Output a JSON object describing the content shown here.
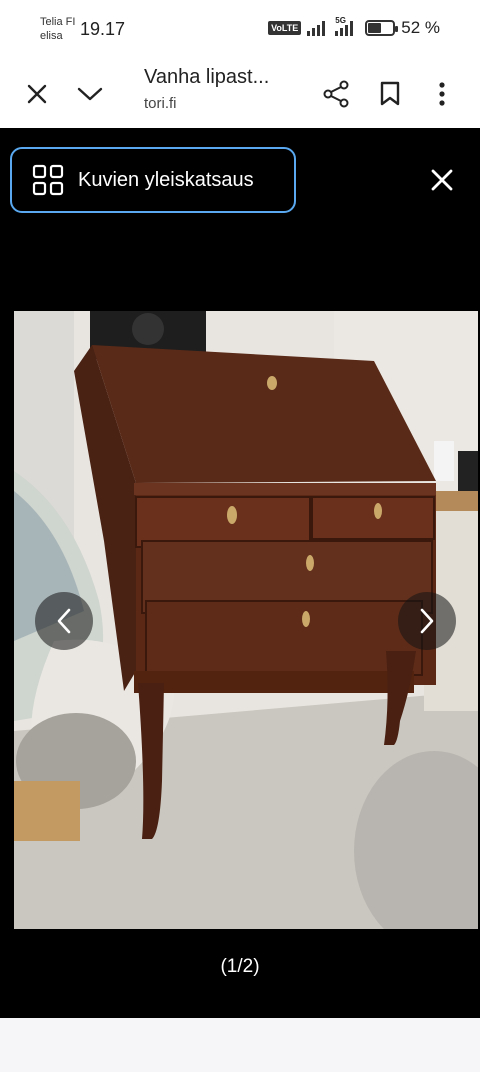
{
  "status_bar": {
    "carrier_line1": "Telia FI",
    "carrier_line2": "elisa",
    "time": "19.17",
    "volte": "VoLTE",
    "network": "5G",
    "battery_percent": "52 %",
    "battery_level": 0.52
  },
  "toolbar": {
    "title": "Vanha lipast...",
    "url": "tori.fi",
    "icons": [
      "close-icon",
      "chevron-down-icon",
      "share-icon",
      "bookmark-icon",
      "more-vert-icon"
    ]
  },
  "viewer": {
    "overview_label": "Kuvien yleiskatsaus",
    "counter": "(1/2)",
    "accent": "#5aa9f0",
    "photo_description_icon": "photo-writing-desk"
  }
}
